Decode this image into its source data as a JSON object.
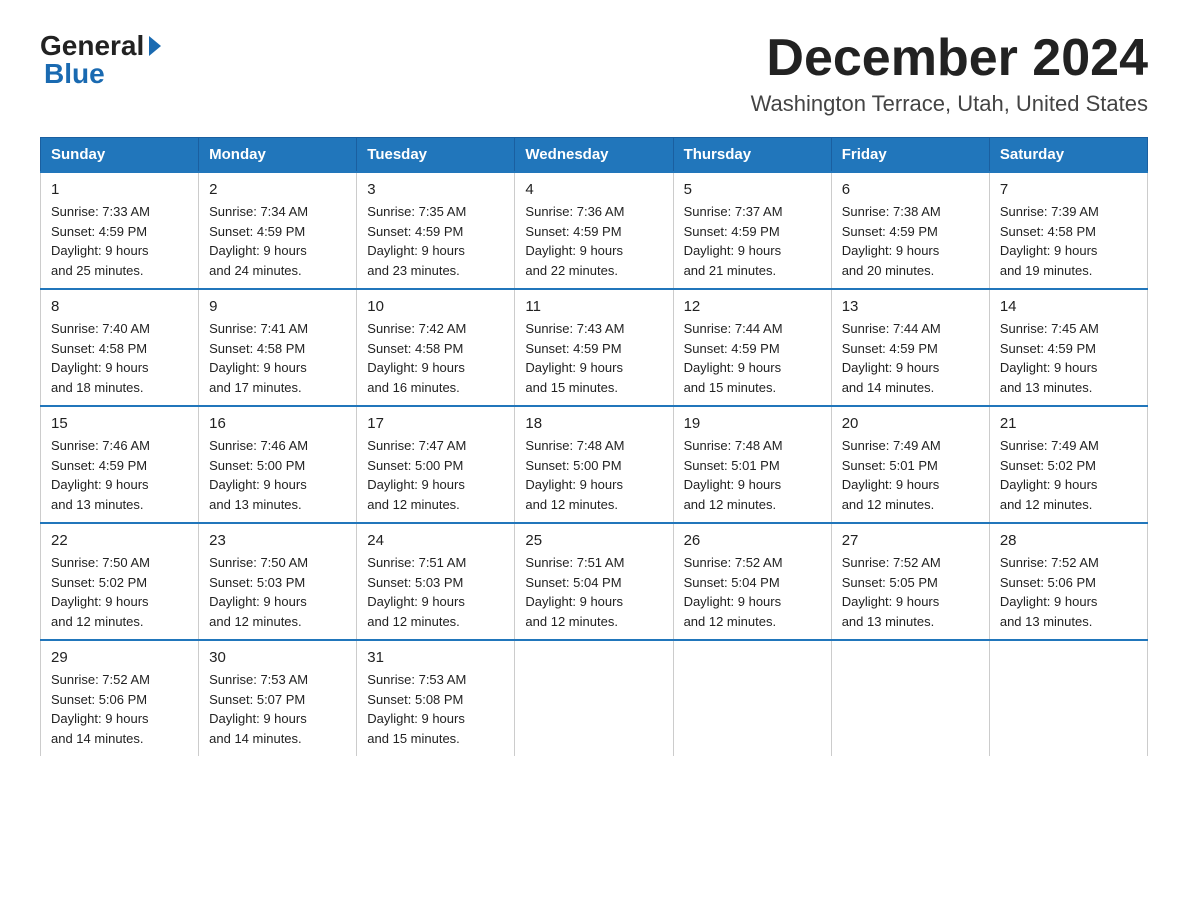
{
  "header": {
    "logo_general": "General",
    "logo_blue": "Blue",
    "month_title": "December 2024",
    "location": "Washington Terrace, Utah, United States"
  },
  "weekdays": [
    "Sunday",
    "Monday",
    "Tuesday",
    "Wednesday",
    "Thursday",
    "Friday",
    "Saturday"
  ],
  "weeks": [
    [
      {
        "day": "1",
        "sunrise": "7:33 AM",
        "sunset": "4:59 PM",
        "daylight": "9 hours and 25 minutes."
      },
      {
        "day": "2",
        "sunrise": "7:34 AM",
        "sunset": "4:59 PM",
        "daylight": "9 hours and 24 minutes."
      },
      {
        "day": "3",
        "sunrise": "7:35 AM",
        "sunset": "4:59 PM",
        "daylight": "9 hours and 23 minutes."
      },
      {
        "day": "4",
        "sunrise": "7:36 AM",
        "sunset": "4:59 PM",
        "daylight": "9 hours and 22 minutes."
      },
      {
        "day": "5",
        "sunrise": "7:37 AM",
        "sunset": "4:59 PM",
        "daylight": "9 hours and 21 minutes."
      },
      {
        "day": "6",
        "sunrise": "7:38 AM",
        "sunset": "4:59 PM",
        "daylight": "9 hours and 20 minutes."
      },
      {
        "day": "7",
        "sunrise": "7:39 AM",
        "sunset": "4:58 PM",
        "daylight": "9 hours and 19 minutes."
      }
    ],
    [
      {
        "day": "8",
        "sunrise": "7:40 AM",
        "sunset": "4:58 PM",
        "daylight": "9 hours and 18 minutes."
      },
      {
        "day": "9",
        "sunrise": "7:41 AM",
        "sunset": "4:58 PM",
        "daylight": "9 hours and 17 minutes."
      },
      {
        "day": "10",
        "sunrise": "7:42 AM",
        "sunset": "4:58 PM",
        "daylight": "9 hours and 16 minutes."
      },
      {
        "day": "11",
        "sunrise": "7:43 AM",
        "sunset": "4:59 PM",
        "daylight": "9 hours and 15 minutes."
      },
      {
        "day": "12",
        "sunrise": "7:44 AM",
        "sunset": "4:59 PM",
        "daylight": "9 hours and 15 minutes."
      },
      {
        "day": "13",
        "sunrise": "7:44 AM",
        "sunset": "4:59 PM",
        "daylight": "9 hours and 14 minutes."
      },
      {
        "day": "14",
        "sunrise": "7:45 AM",
        "sunset": "4:59 PM",
        "daylight": "9 hours and 13 minutes."
      }
    ],
    [
      {
        "day": "15",
        "sunrise": "7:46 AM",
        "sunset": "4:59 PM",
        "daylight": "9 hours and 13 minutes."
      },
      {
        "day": "16",
        "sunrise": "7:46 AM",
        "sunset": "5:00 PM",
        "daylight": "9 hours and 13 minutes."
      },
      {
        "day": "17",
        "sunrise": "7:47 AM",
        "sunset": "5:00 PM",
        "daylight": "9 hours and 12 minutes."
      },
      {
        "day": "18",
        "sunrise": "7:48 AM",
        "sunset": "5:00 PM",
        "daylight": "9 hours and 12 minutes."
      },
      {
        "day": "19",
        "sunrise": "7:48 AM",
        "sunset": "5:01 PM",
        "daylight": "9 hours and 12 minutes."
      },
      {
        "day": "20",
        "sunrise": "7:49 AM",
        "sunset": "5:01 PM",
        "daylight": "9 hours and 12 minutes."
      },
      {
        "day": "21",
        "sunrise": "7:49 AM",
        "sunset": "5:02 PM",
        "daylight": "9 hours and 12 minutes."
      }
    ],
    [
      {
        "day": "22",
        "sunrise": "7:50 AM",
        "sunset": "5:02 PM",
        "daylight": "9 hours and 12 minutes."
      },
      {
        "day": "23",
        "sunrise": "7:50 AM",
        "sunset": "5:03 PM",
        "daylight": "9 hours and 12 minutes."
      },
      {
        "day": "24",
        "sunrise": "7:51 AM",
        "sunset": "5:03 PM",
        "daylight": "9 hours and 12 minutes."
      },
      {
        "day": "25",
        "sunrise": "7:51 AM",
        "sunset": "5:04 PM",
        "daylight": "9 hours and 12 minutes."
      },
      {
        "day": "26",
        "sunrise": "7:52 AM",
        "sunset": "5:04 PM",
        "daylight": "9 hours and 12 minutes."
      },
      {
        "day": "27",
        "sunrise": "7:52 AM",
        "sunset": "5:05 PM",
        "daylight": "9 hours and 13 minutes."
      },
      {
        "day": "28",
        "sunrise": "7:52 AM",
        "sunset": "5:06 PM",
        "daylight": "9 hours and 13 minutes."
      }
    ],
    [
      {
        "day": "29",
        "sunrise": "7:52 AM",
        "sunset": "5:06 PM",
        "daylight": "9 hours and 14 minutes."
      },
      {
        "day": "30",
        "sunrise": "7:53 AM",
        "sunset": "5:07 PM",
        "daylight": "9 hours and 14 minutes."
      },
      {
        "day": "31",
        "sunrise": "7:53 AM",
        "sunset": "5:08 PM",
        "daylight": "9 hours and 15 minutes."
      },
      null,
      null,
      null,
      null
    ]
  ],
  "labels": {
    "sunrise": "Sunrise:",
    "sunset": "Sunset:",
    "daylight": "Daylight:"
  }
}
